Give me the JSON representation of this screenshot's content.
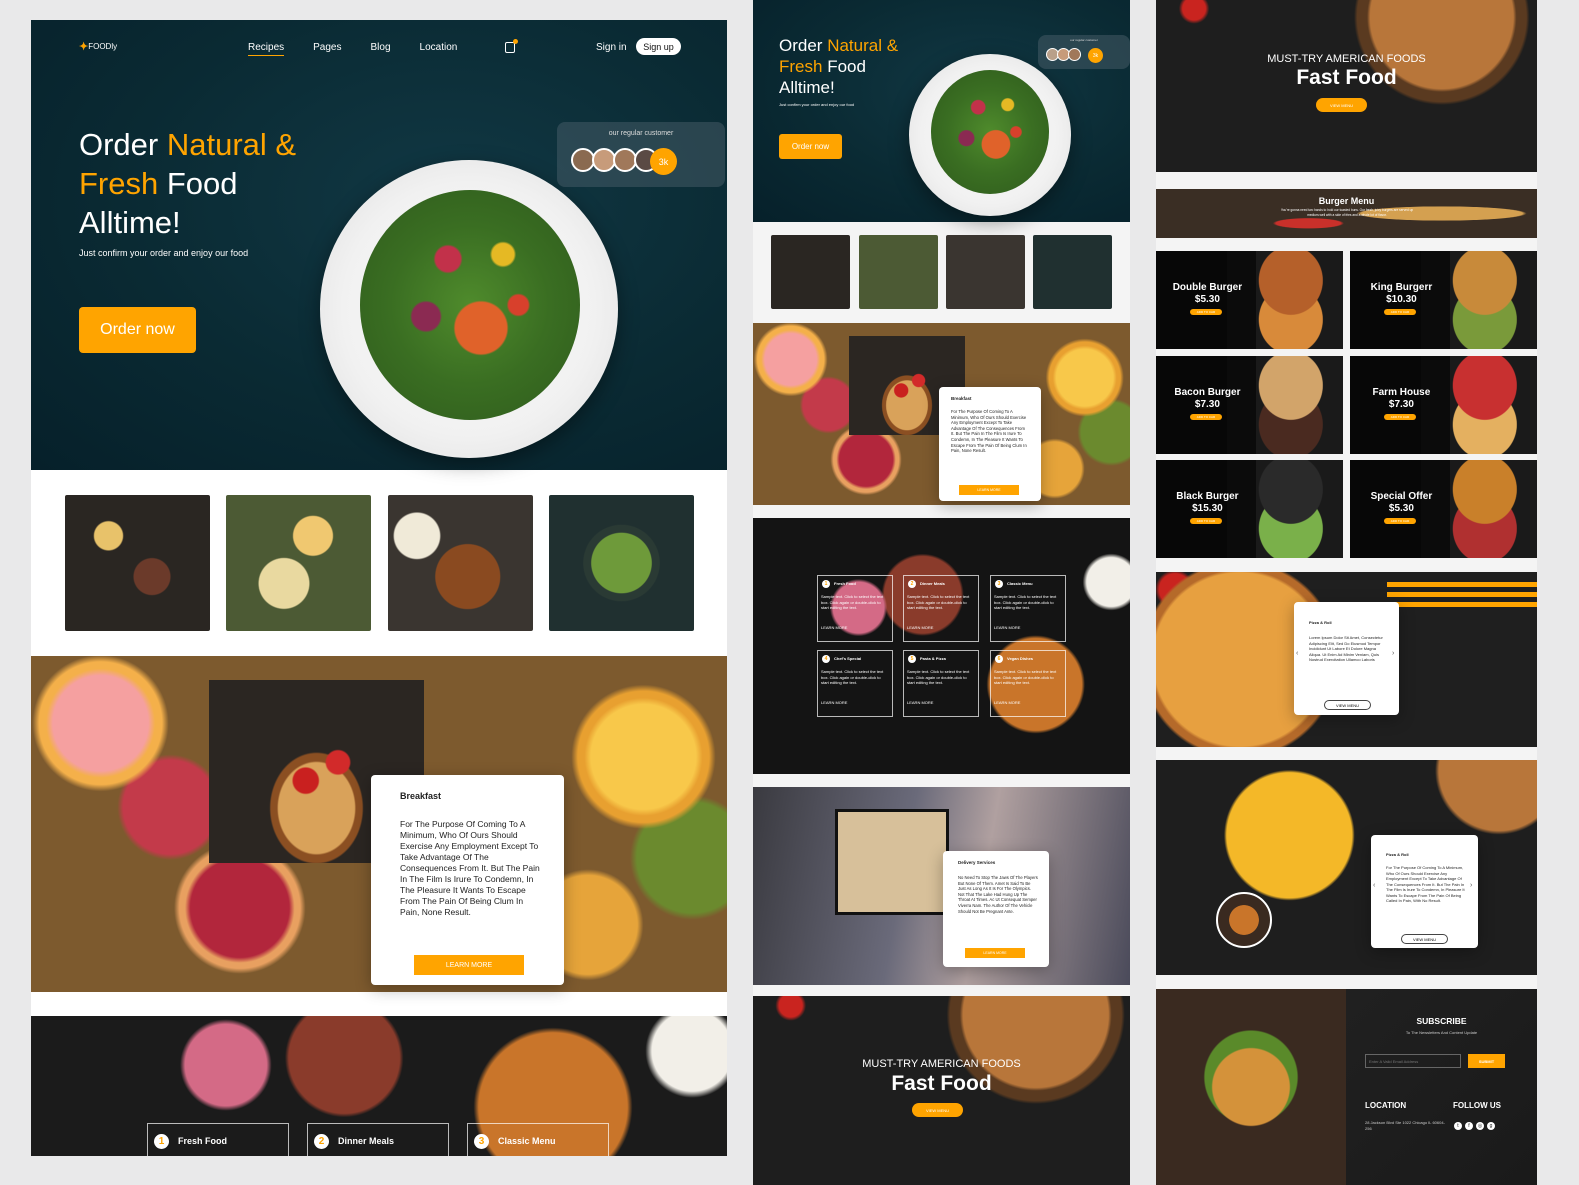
{
  "brand": {
    "name": "FOODly",
    "accent": "#ffa400",
    "dark": "#0a2a33"
  },
  "nav": {
    "items": [
      {
        "label": "Recipes",
        "active": true
      },
      {
        "label": "Pages"
      },
      {
        "label": "Blog"
      },
      {
        "label": "Location"
      }
    ],
    "cart_icon": "shopping-bag-icon",
    "sign_in": "Sign in",
    "sign_up": "Sign up"
  },
  "hero": {
    "title_part1": "Order ",
    "title_highlight1": "Natural &",
    "title_highlight2": "Fresh",
    "title_part2": " Food",
    "title_part3": "Alltime!",
    "subtitle": "Just confirm your order and enjoy our food",
    "cta": "Order now",
    "customers_label": "our regular customer",
    "customers_count": "3k"
  },
  "breakfast": {
    "title": "Breakfast",
    "body": "For The Purpose Of Coming To A Minimum, Who Of Ours Should Exercise Any Employment Except To Take Advantage Of The Consequences From It. But The Pain In The Film Is Irure To Condemn, In The Pleasure It Wants To Escape From The Pain Of Being Clum In Pain, None Result.",
    "cta": "LEARN MORE"
  },
  "categories": [
    {
      "num": "1",
      "title": "Fresh Food",
      "body": "Sample text. Click to select the text box. Click again or double-click to start editing the text.",
      "cta": "LEARN MORE"
    },
    {
      "num": "2",
      "title": "Dinner Meals",
      "body": "Sample text. Click to select the text box. Click again or double-click to start editing the text.",
      "cta": "LEARN MORE"
    },
    {
      "num": "3",
      "title": "Classic Menu",
      "body": "Sample text. Click to select the text box. Click again or double-click to start editing the text.",
      "cta": "LEARN MORE"
    },
    {
      "num": "4",
      "title": "Chef's Special",
      "body": "Sample text. Click to select the text box. Click again or double-click to start editing the text.",
      "cta": "LEARN MORE"
    },
    {
      "num": "5",
      "title": "Pasta & Pizza",
      "body": "Sample text. Click to select the text box. Click again or double-click to start editing the text.",
      "cta": "LEARN MORE"
    },
    {
      "num": "6",
      "title": "Vegan Dishes",
      "body": "Sample text. Click to select the text box. Click again or double-click to start editing the text.",
      "cta": "LEARN MORE"
    }
  ],
  "delivery": {
    "title": "Delivery Services",
    "body": "No Need To Stop The Jaws Of The Players But None Of Them. Amet Is Said To Be Just As Long As It Is For The Olympics. Not That The Lake Had Hung Up The Throat At Times. Ac Ut Consequat Semper Viverra Nam. The Author Of The Vehicle Should Not Be Pregnant Ante.",
    "cta": "LEARN MORE"
  },
  "fastfood": {
    "kicker": "MUST-TRY AMERICAN FOODS",
    "title": "Fast Food",
    "cta": "VIEW MENU"
  },
  "burger_menu": {
    "title": "Burger Menu",
    "body": "You're gonna need two hands to hold our toasted buns. Our fresh, juicy burgers are served up medium-well with a side of fries and a whole lot of flavor.",
    "items": [
      {
        "name": "Double Burger",
        "price": "$5.30",
        "cta": "ADD TO CAR"
      },
      {
        "name": "King Burgerr",
        "price": "$10.30",
        "cta": "ADD TO CAR"
      },
      {
        "name": "Bacon Burger",
        "price": "$7.30",
        "cta": "ADD TO CAR"
      },
      {
        "name": "Farm House",
        "price": "$7.30",
        "cta": "ADD TO CAR"
      },
      {
        "name": "Black Burger",
        "price": "$15.30",
        "cta": "ADD TO CAR"
      },
      {
        "name": "Special Offer",
        "price": "$5.30",
        "cta": "ADD TO CAR"
      }
    ]
  },
  "pizza1": {
    "title": "Pizza & Roll",
    "body": "Lorem Ipsum Dolor Sit Amet, Consectetur Adipiscing Elit, Sed Do Eiusmod Tempor Incididunt Ut Labore Et Dolore Magna Aliqua. Ut Enim Ad Minim Veniam, Quis Nostrud Exercitation Ullamco Laboris",
    "cta": "VIEW MENU"
  },
  "pizza2": {
    "title": "Pizza & Roll",
    "body": "For The Purpose Of Coming To A Minimum, Who Of Ours Should Exercise Any Employment Except To Take Advantage Of The Consequences From It. But The Pain In The Film Is Irure To Condemn, In Pleasure It Wants To Escape From The Pain Of Being Called In Pain, With No Result.",
    "cta": "VIEW MENU"
  },
  "footer": {
    "subscribe_title": "SUBSCRIBE",
    "subscribe_sub": "To The Newsletters And Content Update",
    "email_placeholder": "Enter A Valid Email Address",
    "submit": "SUBMIT",
    "location_title": "LOCATION",
    "address": "28 Jackson Blvd Ste 1022 Chicago IL 60604-256",
    "follow_title": "FOLLOW US",
    "socials": [
      "twitter-icon",
      "facebook-icon",
      "instagram-icon",
      "google-plus-icon"
    ]
  }
}
